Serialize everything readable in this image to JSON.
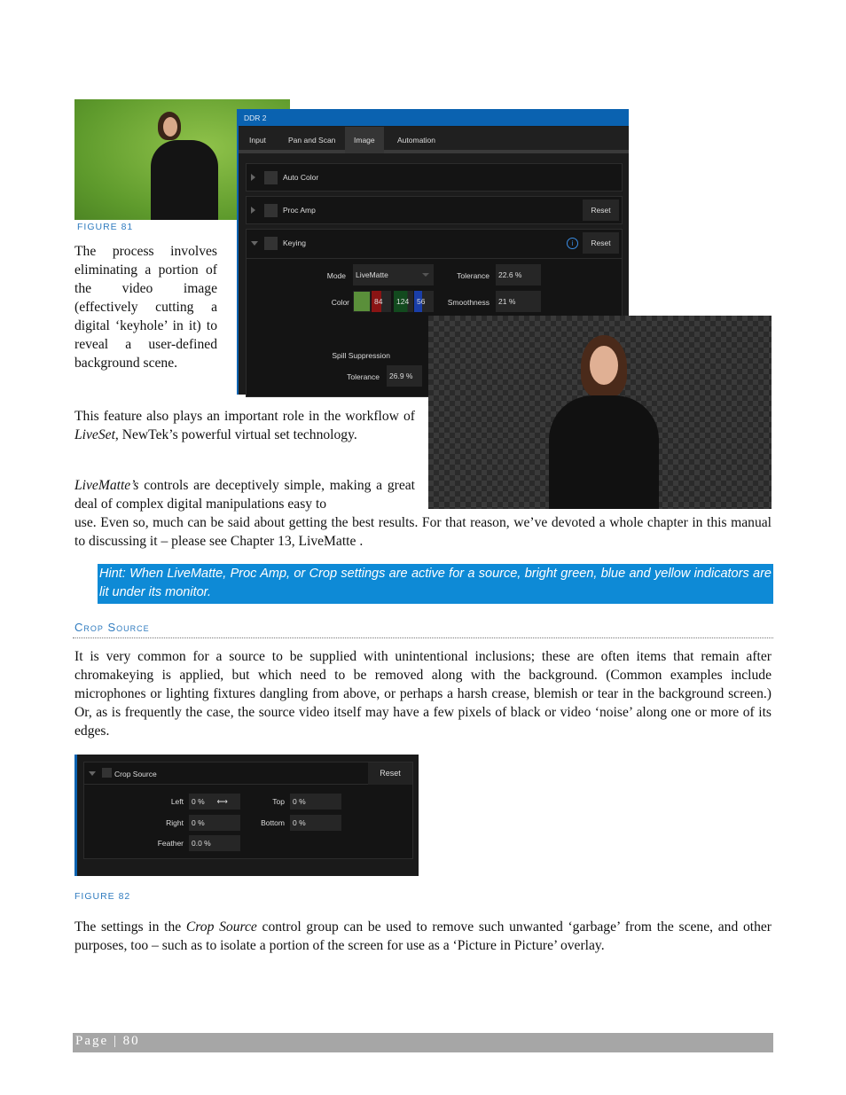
{
  "figure81": {
    "caption": "FIGURE 81"
  },
  "ddr_panel": {
    "title": "DDR 2",
    "tabs": [
      {
        "label": "Input"
      },
      {
        "label": "Pan and Scan"
      },
      {
        "label": "Image",
        "active": true
      },
      {
        "label": "Automation"
      }
    ],
    "groups": {
      "auto_color": "Auto Color",
      "proc_amp": "Proc Amp",
      "keying": "Keying",
      "reset": "Reset"
    },
    "keying": {
      "mode_label": "Mode",
      "mode_value": "LiveMatte",
      "color_label": "Color",
      "swatch": "#5a8f3a",
      "r": "84",
      "g": "124",
      "b": "56",
      "tolerance_label": "Tolerance",
      "tolerance_value": "22.6 %",
      "smoothness_label": "Smoothness",
      "smoothness_value": "21 %",
      "spill_label": "Spill Suppression",
      "spill_tolerance_label": "Tolerance",
      "spill_tolerance_value": "26.9 %"
    }
  },
  "para1": "The process involves eliminating a portion of the video image (effectively cutting a digital ‘keyhole’ in it) to reveal a user-defined background scene.",
  "para2": {
    "a": "This feature also plays an important role in the workflow of ",
    "em": "LiveSet",
    "b": ", NewTek’s powerful virtual set technology."
  },
  "para3": {
    "em": "LiveMatte’s",
    "a": " controls are deceptively simple, making a great deal of complex digital manipulations easy to",
    "b": "use.  Even so, much can be said about getting the best results.  For that reason, we’ve devoted a whole chapter in this manual to discussing it – please see Chapter 13, LiveMatte ."
  },
  "hint": "Hint: When LiveMatte, Proc Amp, or Crop settings are active for a source, bright green, blue and yellow indicators are lit under its monitor.",
  "section_heading": "Crop Source",
  "para4": "It is very common for a source to be supplied with unintentional inclusions; these are often items that remain after chromakeying is applied, but which need to be removed along with the background. (Common examples include microphones or lighting fixtures dangling from above, or perhaps a harsh crease, blemish or tear in the background screen.)  Or, as is frequently the case, the source video itself may have a few pixels of black or video ‘noise’ along one or more of its edges.",
  "crop_panel": {
    "title": "Crop Source",
    "reset": "Reset",
    "left_label": "Left",
    "left_value": "0 %",
    "top_label": "Top",
    "top_value": "0 %",
    "right_label": "Right",
    "right_value": "0 %",
    "bottom_label": "Bottom",
    "bottom_value": "0 %",
    "feather_label": "Feather",
    "feather_value": "0.0 %"
  },
  "figure82": {
    "caption": "FIGURE 82"
  },
  "para5": {
    "a": "The settings in the ",
    "em": "Crop Source",
    "b": " control group can be used to remove such unwanted ‘garbage’ from the scene, and other purposes, too – such as to isolate a portion of the screen for use as a ‘Picture in Picture’ overlay."
  },
  "footer": {
    "text": "Page | 80"
  },
  "colors": {
    "accent": "#2f7bbf",
    "hint_bg": "#0e8ad6",
    "panel_blue": "#0a62b0"
  }
}
